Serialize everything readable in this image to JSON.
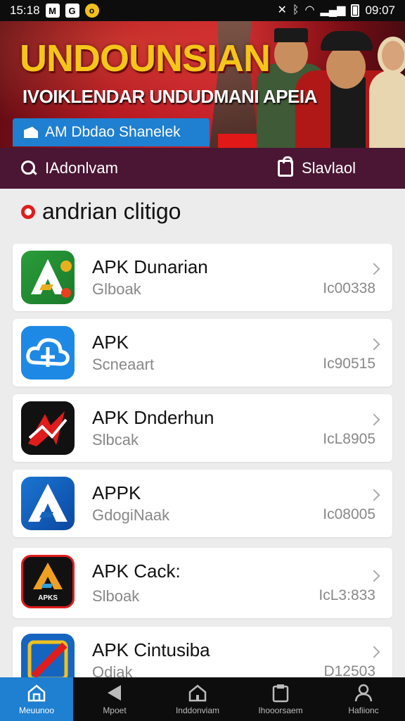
{
  "status": {
    "time_left": "15:18",
    "time_right": "09:07",
    "badge1": "M",
    "badge2": "G",
    "badge3": "o"
  },
  "banner": {
    "title": "UNDOUNSIAN",
    "subtitle": "IVOIKLENDAR UNDUDMANI APEIA",
    "chip_label": "AM Dbdao Shanelek"
  },
  "searchbar": {
    "left_label": "IAdonlvam",
    "right_label": "Slavlaol"
  },
  "section": {
    "title": "andrian clitigo"
  },
  "apps": [
    {
      "name": "APK Dunarian",
      "sub": "Glboak",
      "size": "Ic00338",
      "icon": "android-green-icon",
      "colors": [
        "#2a9d3a",
        "#e8b020"
      ]
    },
    {
      "name": "APK",
      "sub": "Scneaart",
      "size": "Ic90515",
      "icon": "cloud-download-icon",
      "colors": [
        "#1e88e5",
        "#ffffff"
      ]
    },
    {
      "name": "APK  Dnderhun",
      "sub": "Slbcak",
      "size": "IcL8905",
      "icon": "red-arrow-icon",
      "colors": [
        "#111111",
        "#e01c1c"
      ]
    },
    {
      "name": "APPK",
      "sub": "GdogiNaak",
      "size": "Ic08005",
      "icon": "blue-a-icon",
      "colors": [
        "#1565c0",
        "#ffffff"
      ]
    },
    {
      "name": "APK Cack:",
      "sub": "Slboak",
      "size": "IcL3:833",
      "icon": "apks-icon",
      "label": "APKS",
      "colors": [
        "#111111",
        "#f0a020"
      ]
    },
    {
      "name": "APK Cintusiba",
      "sub": "Odiak",
      "size": "D12503",
      "icon": "pencil-icon",
      "colors": [
        "#1565c0",
        "#e01c1c"
      ]
    }
  ],
  "nav": [
    {
      "label": "Meuunoo",
      "icon": "home-icon",
      "active": true
    },
    {
      "label": "Mpoet",
      "icon": "back-icon",
      "active": false
    },
    {
      "label": "Inddonviam",
      "icon": "house-icon",
      "active": false
    },
    {
      "label": "Ihooorsaem",
      "icon": "clipboard-icon",
      "active": false
    },
    {
      "label": "Hafiionc",
      "icon": "profile-icon",
      "active": false
    }
  ]
}
